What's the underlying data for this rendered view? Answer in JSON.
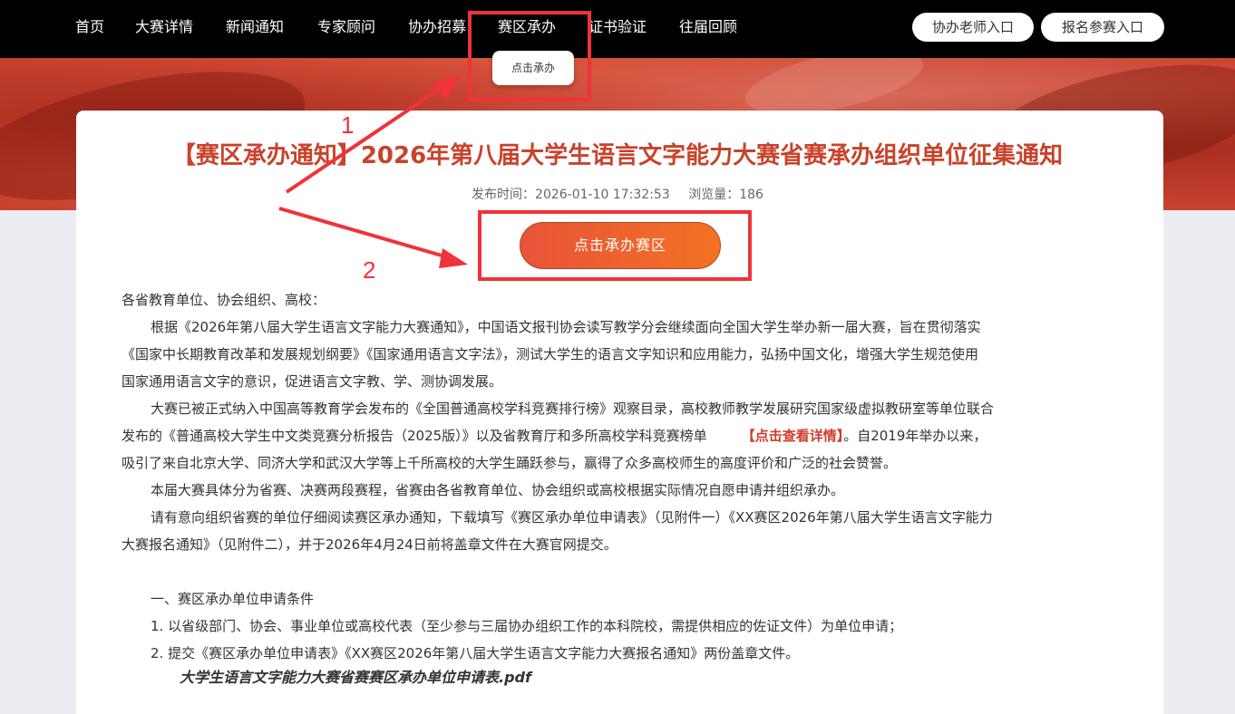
{
  "nav": {
    "items": [
      "首页",
      "大赛详情",
      "新闻通知",
      "专家顾问",
      "协办招募",
      "赛区承办",
      "证书验证",
      "往届回顾"
    ],
    "teacher_entry": "协办老师入口",
    "register_entry": "报名参赛入口",
    "dropdown_item": "点击承办"
  },
  "article": {
    "title": "【赛区承办通知】2026年第八届大学生语言文字能力大赛省赛承办组织单位征集通知",
    "publish_label": "发布时间：2026-01-10 17:32:53",
    "views_label": "浏览量：186",
    "host_button": "点击承办赛区",
    "p1": "各省教育单位、协会组织、高校：",
    "p2a": "根据《2026年第八届大学生语言文字能力大赛通知》，中国语文报刊协会读写教学分会继续面向全国大学生举办新一届大赛，旨在贯彻落实",
    "p2b": "《国家中长期教育改革和发展规划纲要》《国家通用语言文字法》，测试大学生的语言文字知识和应用能力，弘扬中国文化，增强大学生规范使用",
    "p2c": "国家通用语言文字的意识，促进语言文字教、学、测协调发展。",
    "p3a": "大赛已被正式纳入中国高等教育学会发布的《全国普通高校学科竞赛排行榜》观察目录，高校教师教学发展研究国家级虚拟教研室等单位联合",
    "p3b_pre": "发布的《普通高校大学生中文类竞赛分析报告（2025版）》以及省教育厅和多所高校学科竞赛榜单",
    "p3b_link": "【点击查看详情】",
    "p3b_post": "。自2019年举办以来，",
    "p3c": "吸引了来自北京大学、同济大学和武汉大学等上千所高校的大学生踊跃参与，赢得了众多高校师生的高度评价和广泛的社会赞誉。",
    "p4": "本届大赛具体分为省赛、决赛两段赛程，省赛由各省教育单位、协会组织或高校根据实际情况自愿申请并组织承办。",
    "p5a": "请有意向组织省赛的单位仔细阅读赛区承办通知，下载填写《赛区承办单位申请表》（见附件一）《XX赛区2026年第八届大学生语言文字能力",
    "p5b": "大赛报名通知》（见附件二），并于2026年4月24日前将盖章文件在大赛官网提交。",
    "section1": "一、赛区承办单位申请条件",
    "item1": "1. 以省级部门、协会、事业单位或高校代表（至少参与三届协办组织工作的本科院校，需提供相应的佐证文件）为单位申请；",
    "item2": "2. 提交《赛区承办单位申请表》《XX赛区2026年第八届大学生语言文字能力大赛报名通知》两份盖章文件。",
    "attachment": "大学生语言文字能力大赛省赛赛区承办单位申请表.pdf"
  },
  "annotations": {
    "step1": "1",
    "step2": "2",
    "color": "#f0323a"
  },
  "colors": {
    "nav_bg": "#000000",
    "title": "#c8432c",
    "button_start": "#e9533a",
    "button_end": "#f27222",
    "link": "#d23c2a"
  }
}
